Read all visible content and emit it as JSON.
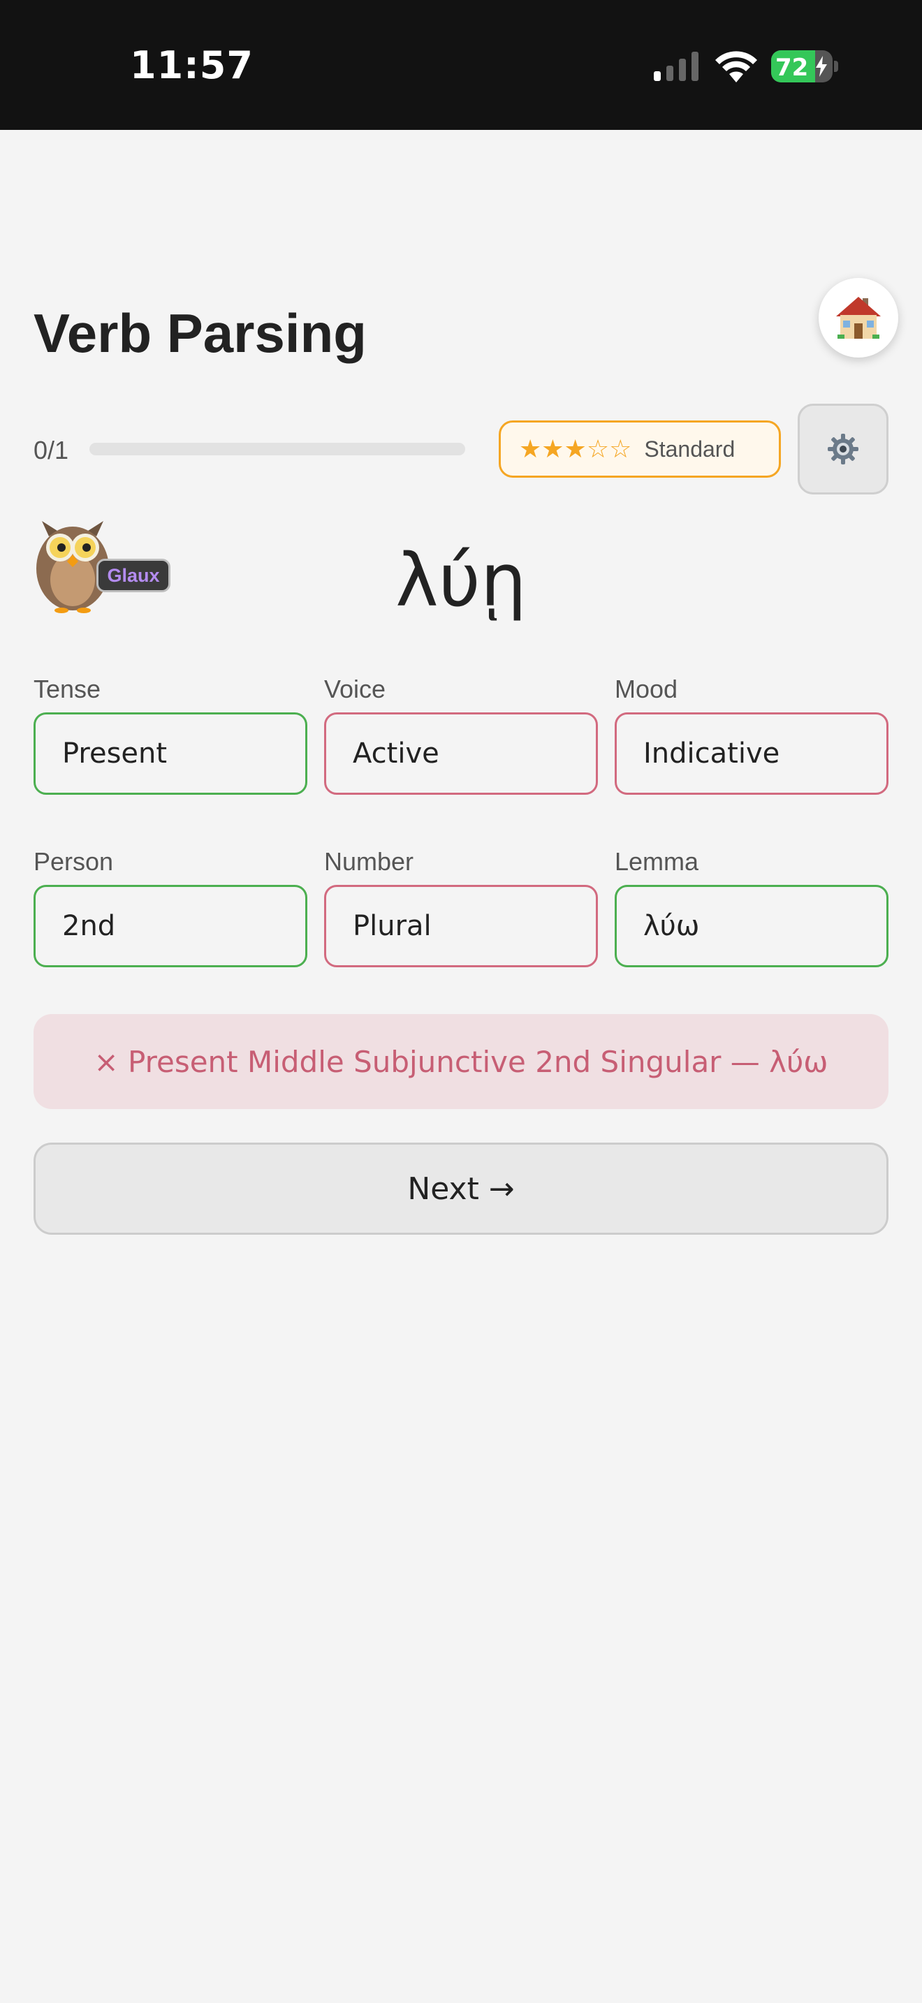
{
  "status_bar": {
    "time": "11:57",
    "battery_percent": "72"
  },
  "header": {
    "title": "Verb Parsing",
    "home_icon": "house-emoji"
  },
  "progress": {
    "label": "0/1",
    "fraction": 0
  },
  "difficulty": {
    "stars": "★★★☆☆",
    "filled_stars": 3,
    "total_stars": 5,
    "label": "Standard"
  },
  "mascot": {
    "name": "Glaux"
  },
  "question": {
    "word": "λύῃ"
  },
  "fields": [
    {
      "label": "Tense",
      "value": "Present",
      "state": "correct"
    },
    {
      "label": "Voice",
      "value": "Active",
      "state": "wrong"
    },
    {
      "label": "Mood",
      "value": "Indicative",
      "state": "wrong"
    },
    {
      "label": "Person",
      "value": "2nd",
      "state": "correct"
    },
    {
      "label": "Number",
      "value": "Plural",
      "state": "wrong"
    },
    {
      "label": "Lemma",
      "value": "λύω",
      "state": "correct"
    }
  ],
  "feedback": {
    "text": "× Present Middle Subjunctive 2nd Singular — λύω"
  },
  "actions": {
    "next_label": "Next →"
  },
  "colors": {
    "correct": "#4caf50",
    "wrong": "#d26a7f",
    "accent": "#f5a623"
  }
}
